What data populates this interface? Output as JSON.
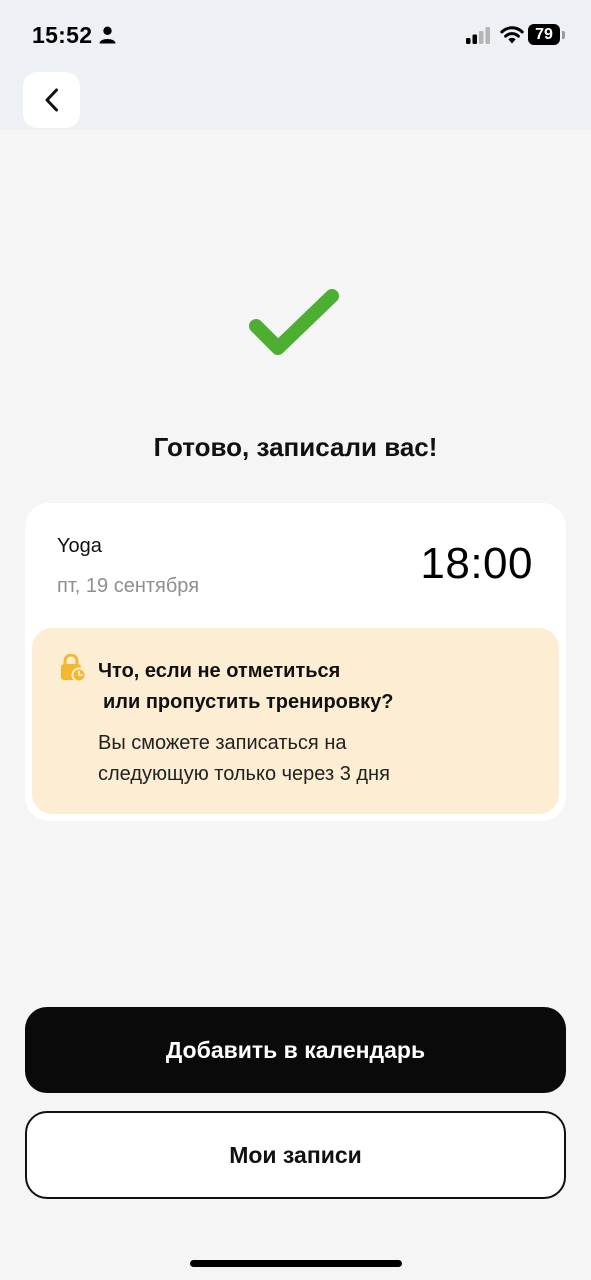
{
  "status_bar": {
    "time": "15:52",
    "battery": "79",
    "icons": [
      "person-icon",
      "cellular-signal-icon",
      "wifi-icon",
      "battery-icon"
    ]
  },
  "header": {
    "back_icon": "chevron-left-icon"
  },
  "success": {
    "icon": "checkmark-icon",
    "title": "Готово, записали вас!"
  },
  "booking": {
    "class_name": "Yoga",
    "date": "пт, 19 сентября",
    "time": "18:00"
  },
  "warning": {
    "icon": "lock-clock-icon",
    "title_line1": "Что, если не отметиться",
    "title_line2": "или пропустить тренировку?",
    "text_line1": "Вы сможете записаться на",
    "text_line2": "следующую только через 3 дня"
  },
  "actions": {
    "add_to_calendar": "Добавить в календарь",
    "my_bookings": "Мои записи"
  },
  "colors": {
    "accent_green": "#4caf32",
    "warning_bg": "#fdeed3",
    "lock_icon": "#f5b731",
    "primary_button": "#0a0a0a"
  }
}
